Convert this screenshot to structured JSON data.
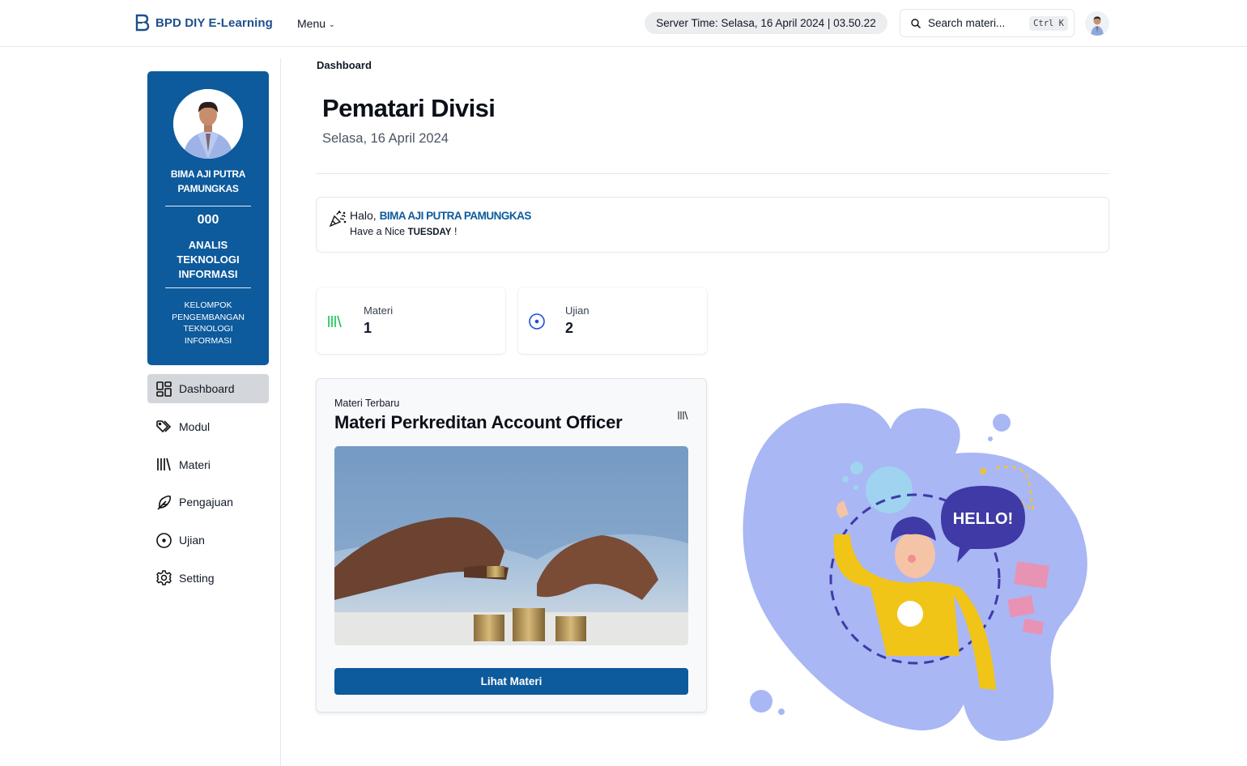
{
  "header": {
    "brand": "BPD DIY E-Learning",
    "menu_label": "Menu",
    "server_time": "Server Time: Selasa, 16 April 2024 | 03.50.22",
    "search_placeholder": "Search materi...",
    "search_shortcut": "Ctrl K"
  },
  "profile": {
    "name": "BIMA AJI PUTRA PAMUNGKAS",
    "id": "000",
    "role": "ANALIS TEKNOLOGI INFORMASI",
    "group": "KELOMPOK PENGEMBANGAN TEKNOLOGI INFORMASI"
  },
  "sidebar": {
    "items": [
      {
        "label": "Dashboard",
        "icon": "dashboard-icon",
        "active": true
      },
      {
        "label": "Modul",
        "icon": "tags-icon"
      },
      {
        "label": "Materi",
        "icon": "library-icon"
      },
      {
        "label": "Pengajuan",
        "icon": "feather-icon"
      },
      {
        "label": "Ujian",
        "icon": "target-icon"
      },
      {
        "label": "Setting",
        "icon": "gear-icon"
      }
    ]
  },
  "main": {
    "breadcrumb": "Dashboard",
    "title": "Pematari Divisi",
    "date": "Selasa, 16 April 2024",
    "greeting": {
      "hello": "Halo,",
      "name": "BIMA AJI PUTRA PAMUNGKAS",
      "line2_prefix": "Have a Nice",
      "day": "TUESDAY",
      "line2_suffix": "!"
    },
    "stats": [
      {
        "label": "Materi",
        "value": "1",
        "icon": "library-icon",
        "color": "#22c55e"
      },
      {
        "label": "Ujian",
        "value": "2",
        "icon": "target-icon",
        "color": "#1d4ed8"
      }
    ],
    "latest": {
      "subtitle": "Materi Terbaru",
      "title": "Materi Perkreditan Account Officer",
      "button": "Lihat Materi"
    },
    "illustration": {
      "bubble_text": "HELLO!"
    }
  },
  "colors": {
    "primary": "#0d5a9c",
    "blob": "#a9b7f4"
  }
}
